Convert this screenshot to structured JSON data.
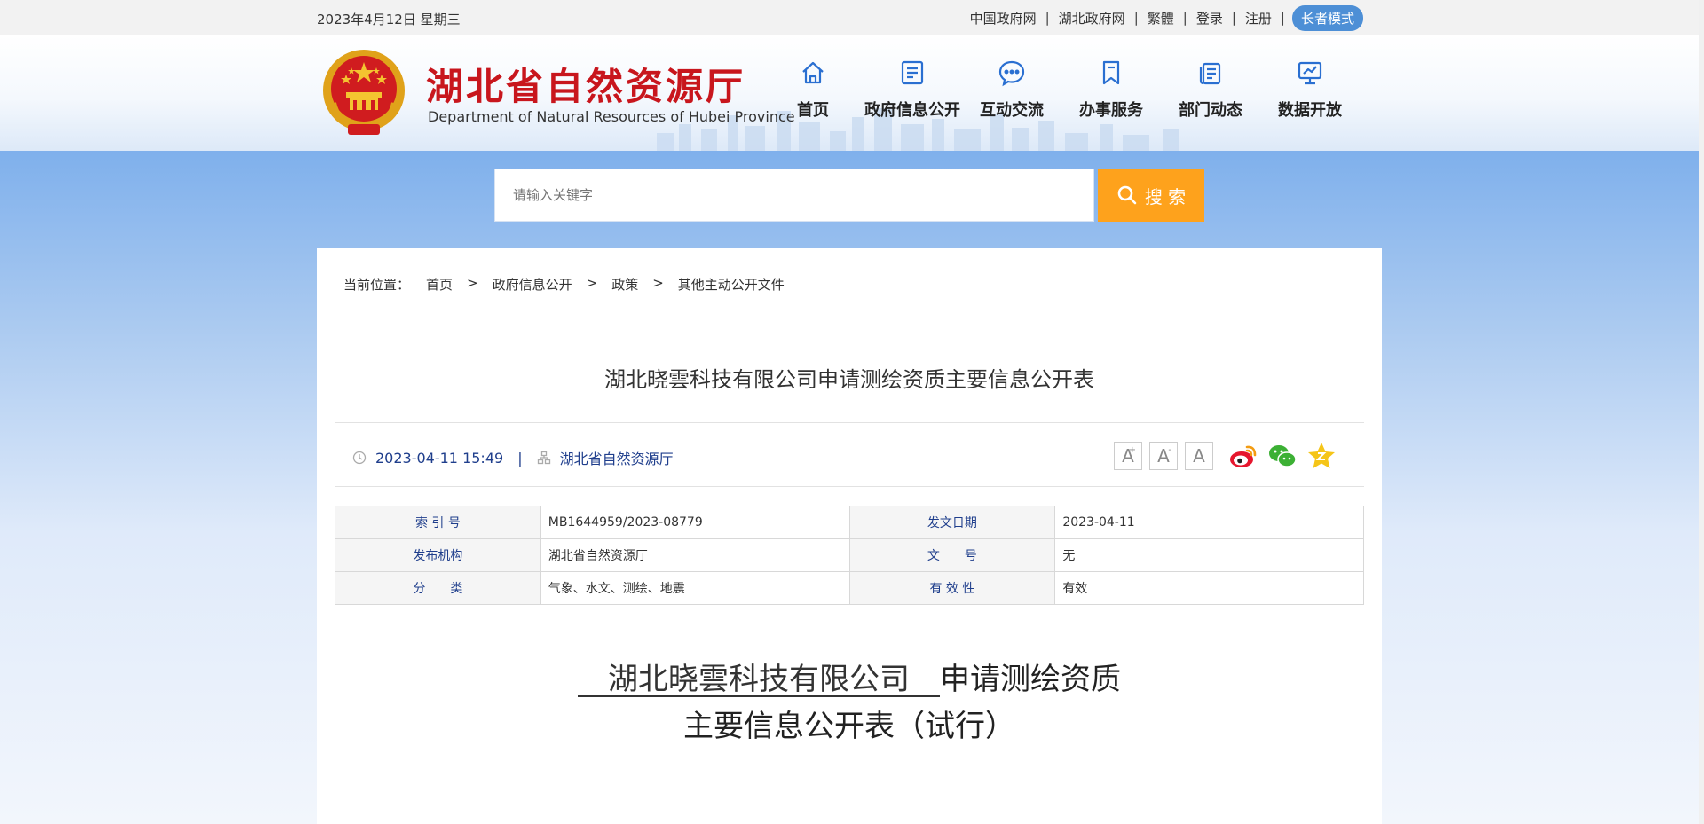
{
  "topbar": {
    "date": "2023年4月12日 星期三",
    "links": [
      "中国政府网",
      "湖北政府网",
      "繁體",
      "登录",
      "注册"
    ],
    "elder_mode": "长者模式"
  },
  "header": {
    "title": "湖北省自然资源厅",
    "subtitle": "Department of Natural Resources of Hubei Province",
    "nav": [
      {
        "label": "首页",
        "icon": "home-icon"
      },
      {
        "label": "政府信息公开",
        "icon": "document-icon"
      },
      {
        "label": "互动交流",
        "icon": "chat-icon"
      },
      {
        "label": "办事服务",
        "icon": "bookmark-icon"
      },
      {
        "label": "部门动态",
        "icon": "news-icon"
      },
      {
        "label": "数据开放",
        "icon": "data-screen-icon"
      }
    ]
  },
  "search": {
    "placeholder": "请输入关键字",
    "button": "搜 索"
  },
  "breadcrumb": {
    "prefix": "当前位置：",
    "items": [
      "首页",
      "政府信息公开",
      "政策",
      "其他主动公开文件"
    ],
    "separator": ">"
  },
  "article": {
    "title": "湖北晓雲科技有限公司申请测绘资质主要信息公开表",
    "datetime": "2023-04-11 15:49",
    "source": "湖北省自然资源厅",
    "font_sizes": [
      "A",
      "A",
      "A"
    ],
    "share": [
      "weibo-icon",
      "wechat-icon",
      "favorite-star-icon"
    ]
  },
  "info_table": [
    [
      "索 引 号",
      "MB1644959/2023-08779",
      "发文日期",
      "2023-04-11"
    ],
    [
      "发布机构",
      "湖北省自然资源厅",
      "文　　号",
      "无"
    ],
    [
      "分　　类",
      "气象、水文、测绘、地震",
      "有 效 性",
      "有效"
    ]
  ],
  "document": {
    "company": "　湖北晓雲科技有限公司　",
    "line1_suffix": "申请测绘资质",
    "line2": "主要信息公开表（试行）"
  },
  "colors": {
    "brand_red": "#c8161d",
    "nav_blue": "#2a6fd1",
    "search_orange": "#fea21c",
    "elder_blue": "#4d8fd6",
    "link_blue": "#1f3e8c"
  }
}
